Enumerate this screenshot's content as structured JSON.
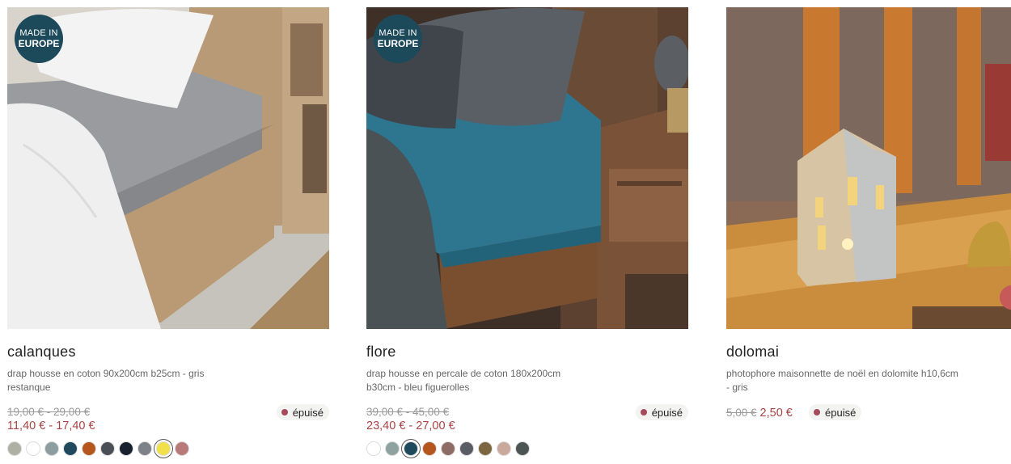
{
  "products": [
    {
      "badge": {
        "line1": "MADE IN",
        "line2": "EUROPE"
      },
      "title": "calanques",
      "description": "drap housse en coton 90x200cm b25cm - gris restanque",
      "old_price": "19,00 € - 29,00 €",
      "new_price": "11,40 € - 17,40 €",
      "stock": "épuisé",
      "swatches": [
        "#aeb0a3",
        "#ffffff",
        "#8c9ea0",
        "#1f4a5e",
        "#b5561c",
        "#4a4e55",
        "#18222f",
        "#7d8288",
        "#f1e04a",
        "#b77a78"
      ],
      "selected_swatch": 8
    },
    {
      "badge": {
        "line1": "MADE IN",
        "line2": "EUROPE"
      },
      "title": "flore",
      "description": "drap housse en percale de coton 180x200cm b30cm - bleu figuerolles",
      "old_price": "39,00 € - 45,00 €",
      "new_price": "23,40 € - 27,00 €",
      "stock": "épuisé",
      "swatches": [
        "#ffffff",
        "#8ea3a0",
        "#1f4a5e",
        "#b5561c",
        "#8e6c66",
        "#5a5d66",
        "#7c6640",
        "#c9a99c",
        "#4c5553"
      ],
      "selected_swatch": 2
    },
    {
      "title": "dolomai",
      "description": "photophore maisonnette de noël en dolomite h10,6cm - gris",
      "old_price": "5,00 €",
      "new_price": "2,50 €",
      "stock": "épuisé",
      "swatches": []
    }
  ]
}
